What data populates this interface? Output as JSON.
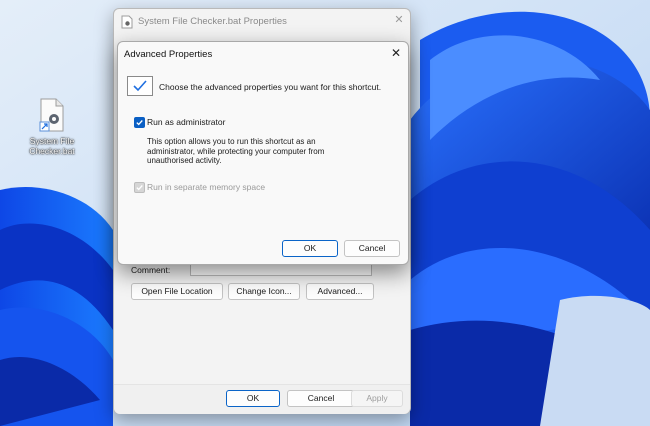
{
  "desktop": {
    "icon": {
      "name": "gear-file-icon",
      "label_line1": "System File",
      "label_line2": "Checker.bat"
    }
  },
  "properties_window": {
    "title": "System File Checker.bat Properties",
    "comment_label": "Comment:",
    "buttons": {
      "open_file_location": "Open File Location",
      "change_icon": "Change Icon...",
      "advanced": "Advanced..."
    },
    "footer": {
      "ok": "OK",
      "cancel": "Cancel",
      "apply": "Apply"
    }
  },
  "advanced_dialog": {
    "title": "Advanced Properties",
    "close": "✕",
    "intro": "Choose the advanced properties you want for this shortcut.",
    "run_as_admin": {
      "label": "Run as administrator",
      "checked": true,
      "description_line1": "This option allows you to run this shortcut as an",
      "description_line2": "administrator, while protecting your computer from",
      "description_line3": "unauthorised activity."
    },
    "separate_memory": {
      "label": "Run in separate memory space",
      "checked": true,
      "disabled": true
    },
    "ok": "OK",
    "cancel": "Cancel"
  },
  "colors": {
    "accent": "#0a5fc4",
    "wallpaper_blue": "#0b3fd8"
  }
}
